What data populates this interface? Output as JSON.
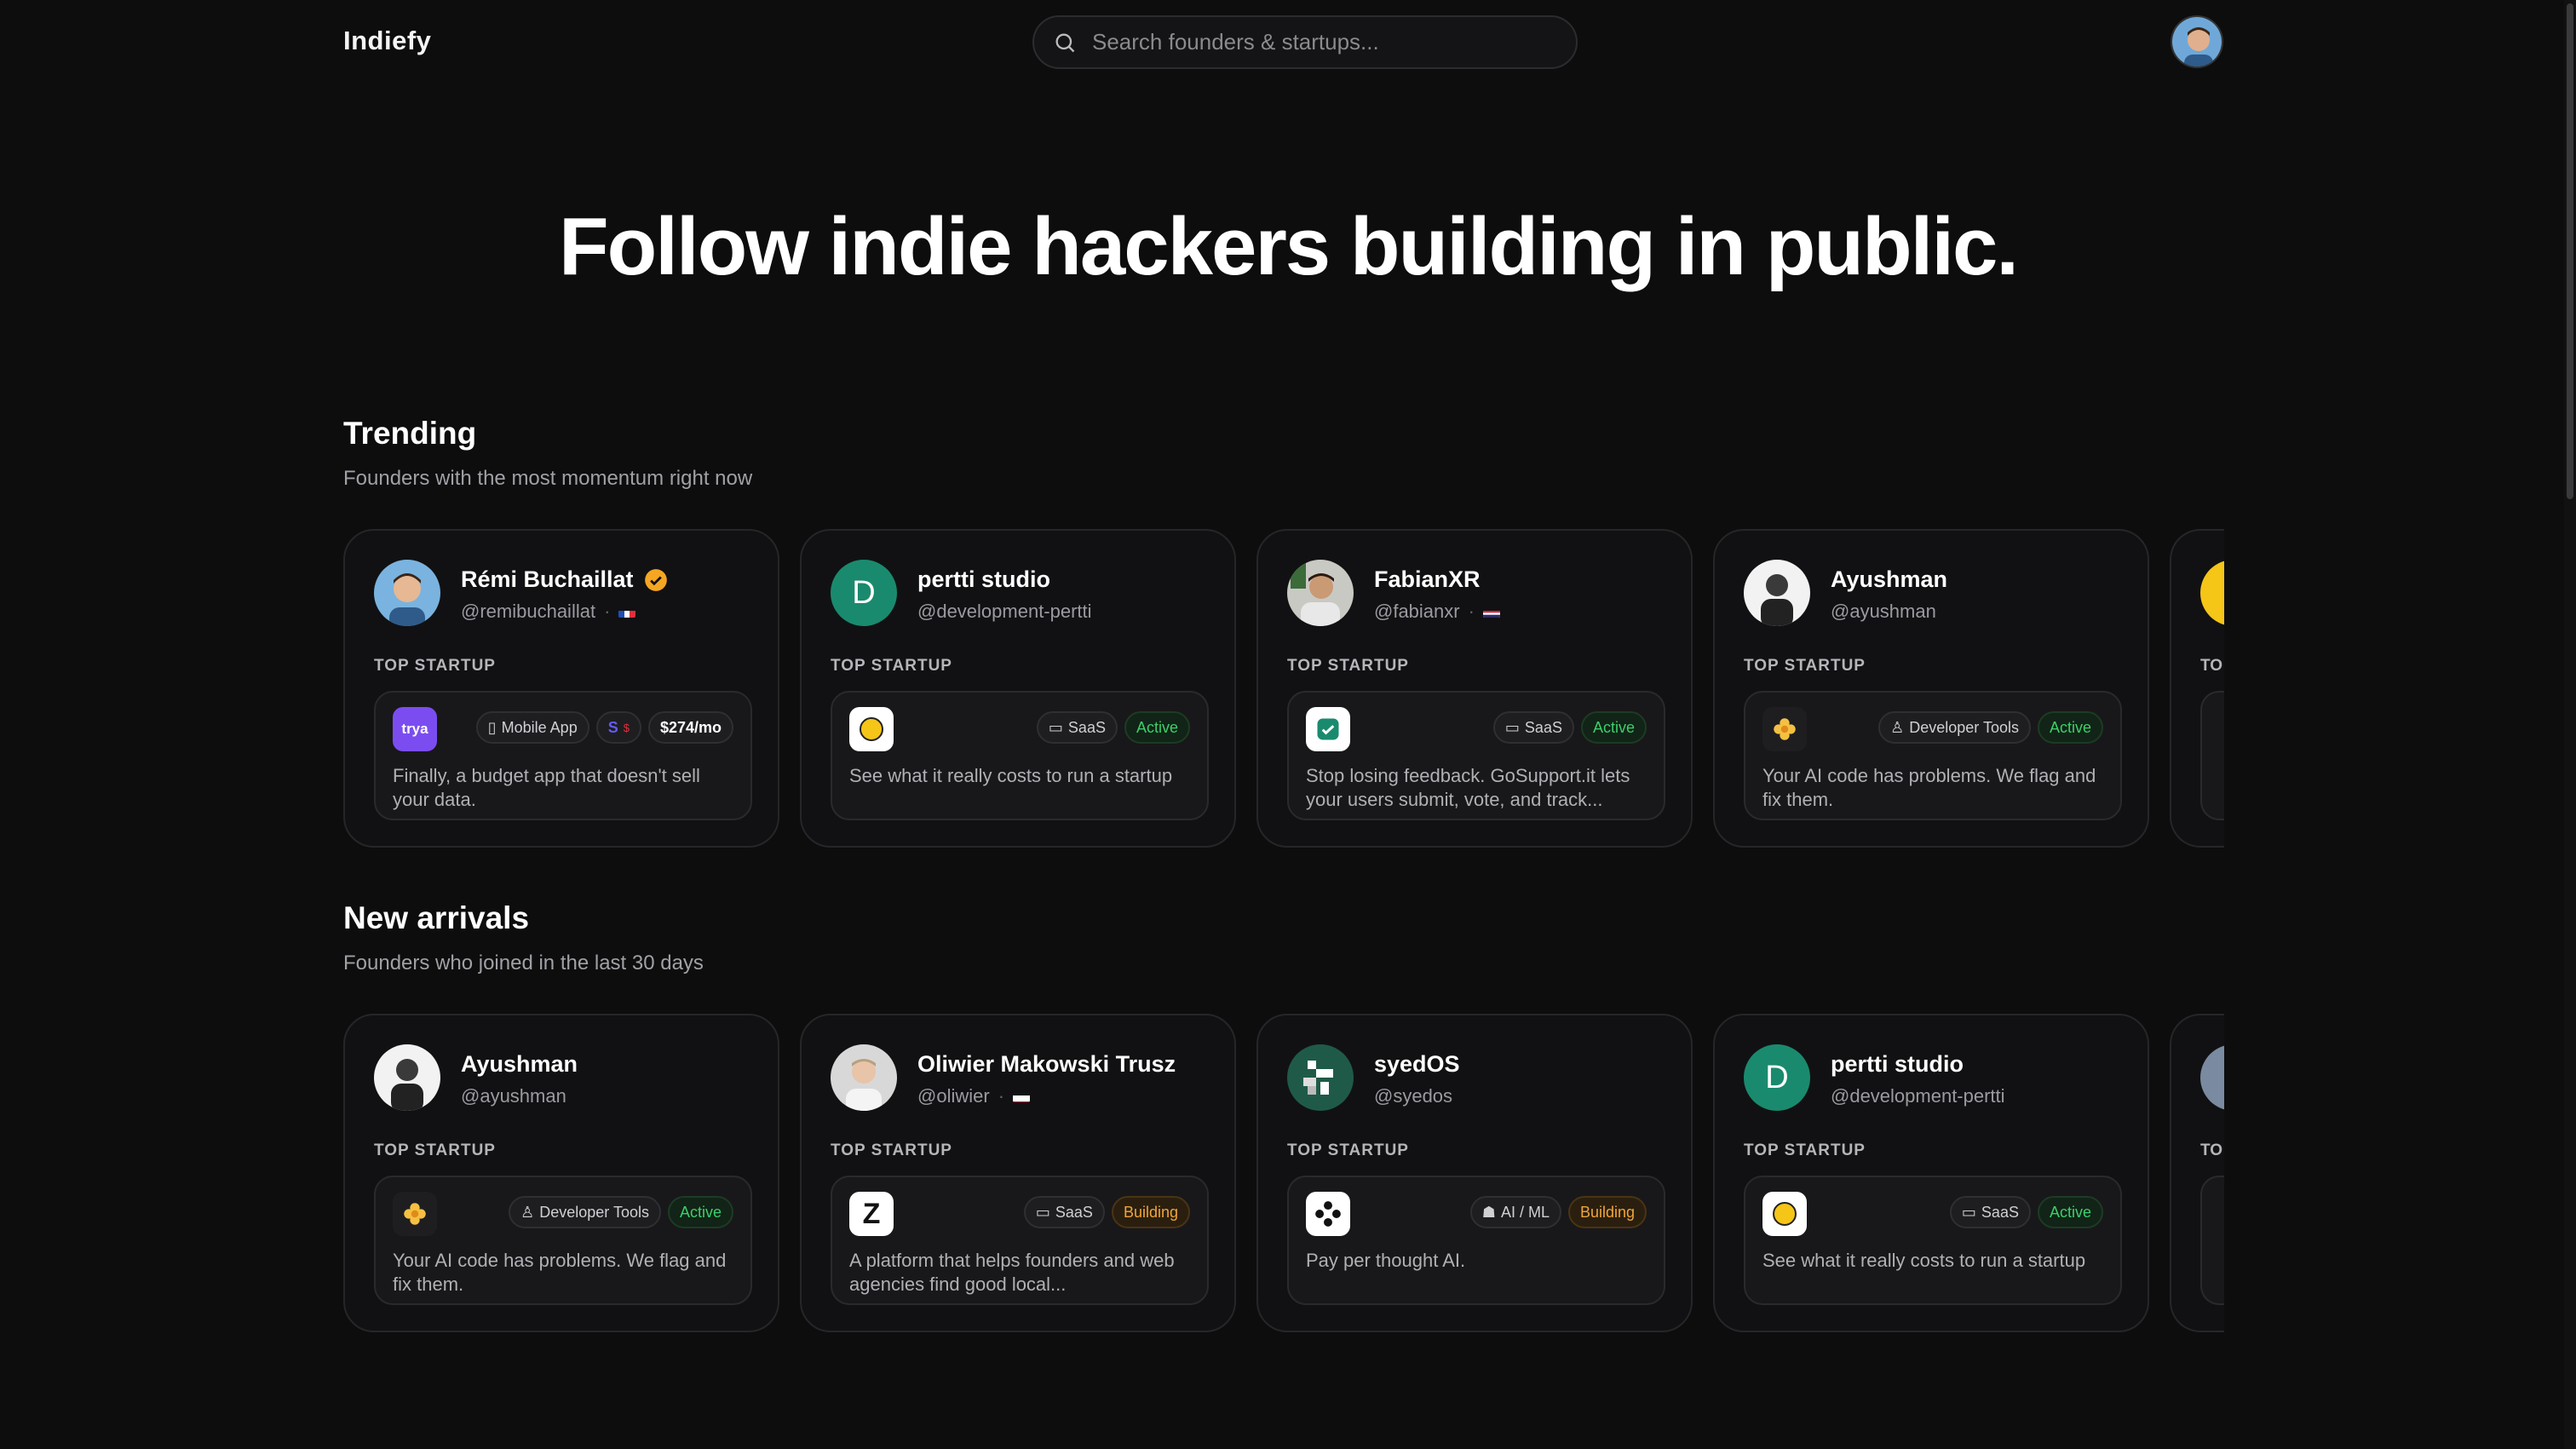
{
  "header": {
    "logo": "Indiefy",
    "search_placeholder": "Search founders & startups..."
  },
  "hero": {
    "title": "Follow indie hackers building in public."
  },
  "trending": {
    "title": "Trending",
    "subtitle": "Founders with the most momentum right now",
    "cards": [
      {
        "name": "Rémi Buchaillat",
        "handle": "@remibuchaillat",
        "top_label": "TOP STARTUP",
        "logo_text": "trya",
        "category": "Mobile App",
        "mrr": "$274/mo",
        "desc": "Finally, a budget app that doesn't sell your data."
      },
      {
        "name": "pertti studio",
        "handle": "@development-pertti",
        "avatar_letter": "D",
        "top_label": "TOP STARTUP",
        "category": "SaaS",
        "status": "Active",
        "desc": "See what it really costs to run a startup"
      },
      {
        "name": "FabianXR",
        "handle": "@fabianxr",
        "top_label": "TOP STARTUP",
        "category": "SaaS",
        "status": "Active",
        "desc": "Stop losing feedback. GoSupport.it lets your users submit, vote, and track..."
      },
      {
        "name": "Ayushman",
        "handle": "@ayushman",
        "top_label": "TOP STARTUP",
        "category": "Developer Tools",
        "status": "Active",
        "desc": "Your AI code has problems. We flag and fix them."
      },
      {
        "top_label": "TO"
      }
    ]
  },
  "new_arrivals": {
    "title": "New arrivals",
    "subtitle": "Founders who joined in the last 30 days",
    "cards": [
      {
        "name": "Ayushman",
        "handle": "@ayushman",
        "top_label": "TOP STARTUP",
        "category": "Developer Tools",
        "status": "Active",
        "desc": "Your AI code has problems. We flag and fix them."
      },
      {
        "name": "Oliwier Makowski Trusz",
        "handle": "@oliwier",
        "top_label": "TOP STARTUP",
        "logo_text": "Z",
        "category": "SaaS",
        "status": "Building",
        "desc": "A platform that helps founders and web agencies find good local..."
      },
      {
        "name": "syedOS",
        "handle": "@syedos",
        "top_label": "TOP STARTUP",
        "category": "AI / ML",
        "status": "Building",
        "desc": "Pay per thought AI."
      },
      {
        "name": "pertti studio",
        "handle": "@development-pertti",
        "avatar_letter": "D",
        "top_label": "TOP STARTUP",
        "category": "SaaS",
        "status": "Active",
        "desc": "See what it really costs to run a startup"
      },
      {
        "top_label": "TO"
      }
    ]
  },
  "colors": {
    "background": "#0d0d0e",
    "card": "#111113",
    "active": "#3ecf6a",
    "building": "#f0a43a",
    "verified": "#f5a623",
    "pertti": "#1a8a6e",
    "trya": "#7b4df0"
  }
}
